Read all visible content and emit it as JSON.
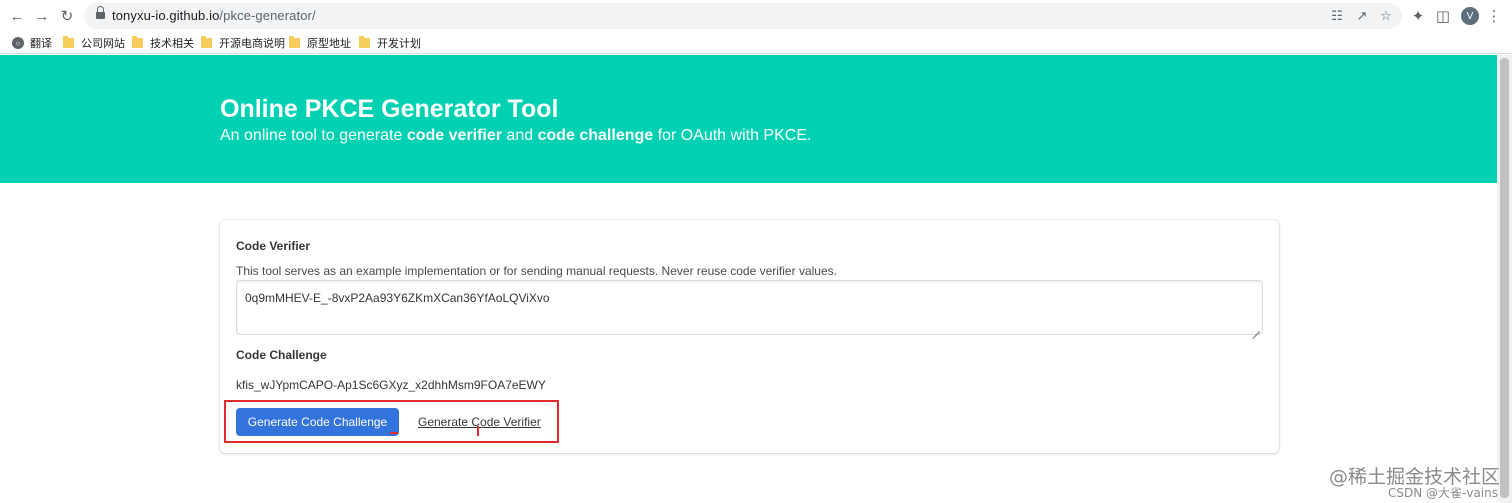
{
  "browser": {
    "url_host": "tonyxu-io.github.io",
    "url_path": "/pkce-generator/",
    "avatar_letter": "V"
  },
  "bookmarks": [
    {
      "label": "翻译"
    },
    {
      "label": "公司网站"
    },
    {
      "label": "技术相关"
    },
    {
      "label": "开源电商说明"
    },
    {
      "label": "原型地址"
    },
    {
      "label": "开发计划"
    }
  ],
  "hero": {
    "title": "Online PKCE Generator Tool",
    "subtitle_pre": "An online tool to generate ",
    "subtitle_b1": "code verifier",
    "subtitle_mid": " and ",
    "subtitle_b2": "code challenge",
    "subtitle_post": " for OAuth with PKCE."
  },
  "verifier": {
    "label": "Code Verifier",
    "help": "This tool serves as an example implementation or for sending manual requests. Never reuse code verifier values.",
    "value": "0q9mMHEV-E_-8vxP2Aa93Y6ZKmXCan36YfAoLQViXvo"
  },
  "challenge": {
    "label": "Code Challenge",
    "value": "kfis_wJYpmCAPO-Ap1Sc6GXyz_x2dhhMsm9FOA7eEWY"
  },
  "actions": {
    "generate_challenge": "Generate Code Challenge",
    "generate_verifier": "Generate Code Verifier"
  },
  "watermark": {
    "line1": "@稀土掘金技术社区",
    "line2": "CSDN @大雀-vains"
  },
  "colors": {
    "hero": "#00d1b2",
    "primary": "#3273dc",
    "highlight": "#e32b2b"
  }
}
